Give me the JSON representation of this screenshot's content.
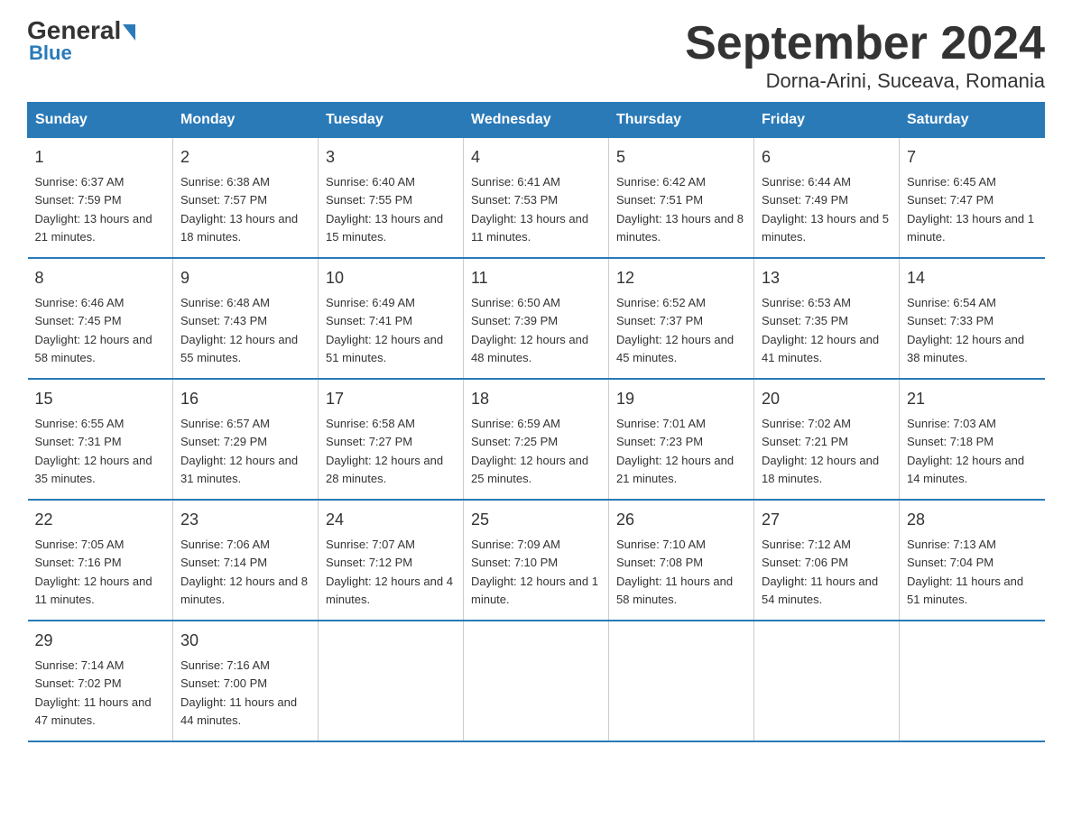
{
  "logo": {
    "general": "General",
    "arrow": true,
    "blue": "Blue"
  },
  "title": "September 2024",
  "subtitle": "Dorna-Arini, Suceava, Romania",
  "days_of_week": [
    "Sunday",
    "Monday",
    "Tuesday",
    "Wednesday",
    "Thursday",
    "Friday",
    "Saturday"
  ],
  "weeks": [
    [
      {
        "day": "1",
        "sunrise": "6:37 AM",
        "sunset": "7:59 PM",
        "daylight": "13 hours and 21 minutes."
      },
      {
        "day": "2",
        "sunrise": "6:38 AM",
        "sunset": "7:57 PM",
        "daylight": "13 hours and 18 minutes."
      },
      {
        "day": "3",
        "sunrise": "6:40 AM",
        "sunset": "7:55 PM",
        "daylight": "13 hours and 15 minutes."
      },
      {
        "day": "4",
        "sunrise": "6:41 AM",
        "sunset": "7:53 PM",
        "daylight": "13 hours and 11 minutes."
      },
      {
        "day": "5",
        "sunrise": "6:42 AM",
        "sunset": "7:51 PM",
        "daylight": "13 hours and 8 minutes."
      },
      {
        "day": "6",
        "sunrise": "6:44 AM",
        "sunset": "7:49 PM",
        "daylight": "13 hours and 5 minutes."
      },
      {
        "day": "7",
        "sunrise": "6:45 AM",
        "sunset": "7:47 PM",
        "daylight": "13 hours and 1 minute."
      }
    ],
    [
      {
        "day": "8",
        "sunrise": "6:46 AM",
        "sunset": "7:45 PM",
        "daylight": "12 hours and 58 minutes."
      },
      {
        "day": "9",
        "sunrise": "6:48 AM",
        "sunset": "7:43 PM",
        "daylight": "12 hours and 55 minutes."
      },
      {
        "day": "10",
        "sunrise": "6:49 AM",
        "sunset": "7:41 PM",
        "daylight": "12 hours and 51 minutes."
      },
      {
        "day": "11",
        "sunrise": "6:50 AM",
        "sunset": "7:39 PM",
        "daylight": "12 hours and 48 minutes."
      },
      {
        "day": "12",
        "sunrise": "6:52 AM",
        "sunset": "7:37 PM",
        "daylight": "12 hours and 45 minutes."
      },
      {
        "day": "13",
        "sunrise": "6:53 AM",
        "sunset": "7:35 PM",
        "daylight": "12 hours and 41 minutes."
      },
      {
        "day": "14",
        "sunrise": "6:54 AM",
        "sunset": "7:33 PM",
        "daylight": "12 hours and 38 minutes."
      }
    ],
    [
      {
        "day": "15",
        "sunrise": "6:55 AM",
        "sunset": "7:31 PM",
        "daylight": "12 hours and 35 minutes."
      },
      {
        "day": "16",
        "sunrise": "6:57 AM",
        "sunset": "7:29 PM",
        "daylight": "12 hours and 31 minutes."
      },
      {
        "day": "17",
        "sunrise": "6:58 AM",
        "sunset": "7:27 PM",
        "daylight": "12 hours and 28 minutes."
      },
      {
        "day": "18",
        "sunrise": "6:59 AM",
        "sunset": "7:25 PM",
        "daylight": "12 hours and 25 minutes."
      },
      {
        "day": "19",
        "sunrise": "7:01 AM",
        "sunset": "7:23 PM",
        "daylight": "12 hours and 21 minutes."
      },
      {
        "day": "20",
        "sunrise": "7:02 AM",
        "sunset": "7:21 PM",
        "daylight": "12 hours and 18 minutes."
      },
      {
        "day": "21",
        "sunrise": "7:03 AM",
        "sunset": "7:18 PM",
        "daylight": "12 hours and 14 minutes."
      }
    ],
    [
      {
        "day": "22",
        "sunrise": "7:05 AM",
        "sunset": "7:16 PM",
        "daylight": "12 hours and 11 minutes."
      },
      {
        "day": "23",
        "sunrise": "7:06 AM",
        "sunset": "7:14 PM",
        "daylight": "12 hours and 8 minutes."
      },
      {
        "day": "24",
        "sunrise": "7:07 AM",
        "sunset": "7:12 PM",
        "daylight": "12 hours and 4 minutes."
      },
      {
        "day": "25",
        "sunrise": "7:09 AM",
        "sunset": "7:10 PM",
        "daylight": "12 hours and 1 minute."
      },
      {
        "day": "26",
        "sunrise": "7:10 AM",
        "sunset": "7:08 PM",
        "daylight": "11 hours and 58 minutes."
      },
      {
        "day": "27",
        "sunrise": "7:12 AM",
        "sunset": "7:06 PM",
        "daylight": "11 hours and 54 minutes."
      },
      {
        "day": "28",
        "sunrise": "7:13 AM",
        "sunset": "7:04 PM",
        "daylight": "11 hours and 51 minutes."
      }
    ],
    [
      {
        "day": "29",
        "sunrise": "7:14 AM",
        "sunset": "7:02 PM",
        "daylight": "11 hours and 47 minutes."
      },
      {
        "day": "30",
        "sunrise": "7:16 AM",
        "sunset": "7:00 PM",
        "daylight": "11 hours and 44 minutes."
      },
      null,
      null,
      null,
      null,
      null
    ]
  ]
}
